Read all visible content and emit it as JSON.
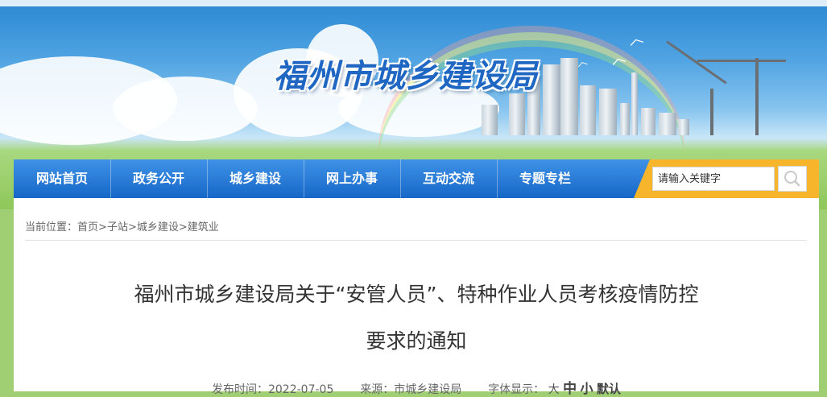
{
  "header": {
    "site_title": "福州市城乡建设局"
  },
  "nav": {
    "items": [
      {
        "label": "网站首页"
      },
      {
        "label": "政务公开"
      },
      {
        "label": "城乡建设"
      },
      {
        "label": "网上办事"
      },
      {
        "label": "互动交流"
      },
      {
        "label": "专题专栏"
      }
    ],
    "search_placeholder": "请输入关键字",
    "search_icon": "search-icon"
  },
  "breadcrumb": {
    "prefix": "当前位置：",
    "items": [
      "首页",
      "子站",
      "城乡建设",
      "建筑业"
    ],
    "separator": ">"
  },
  "article": {
    "title_line1": "福州市城乡建设局关于“安管人员”、特种作业人员考核疫情防控",
    "title_line2": "要求的通知",
    "publish_label": "发布时间：",
    "publish_date": "2022-07-05",
    "source_label": "来源：",
    "source": "市城乡建设局",
    "font_label": "字体显示：",
    "font_large": "大",
    "font_medium": "中",
    "font_small": "小",
    "font_default": "默认"
  },
  "colors": {
    "nav_blue": "#1a6fd0",
    "search_orange": "#f7b52b",
    "title_text": "#333333"
  }
}
